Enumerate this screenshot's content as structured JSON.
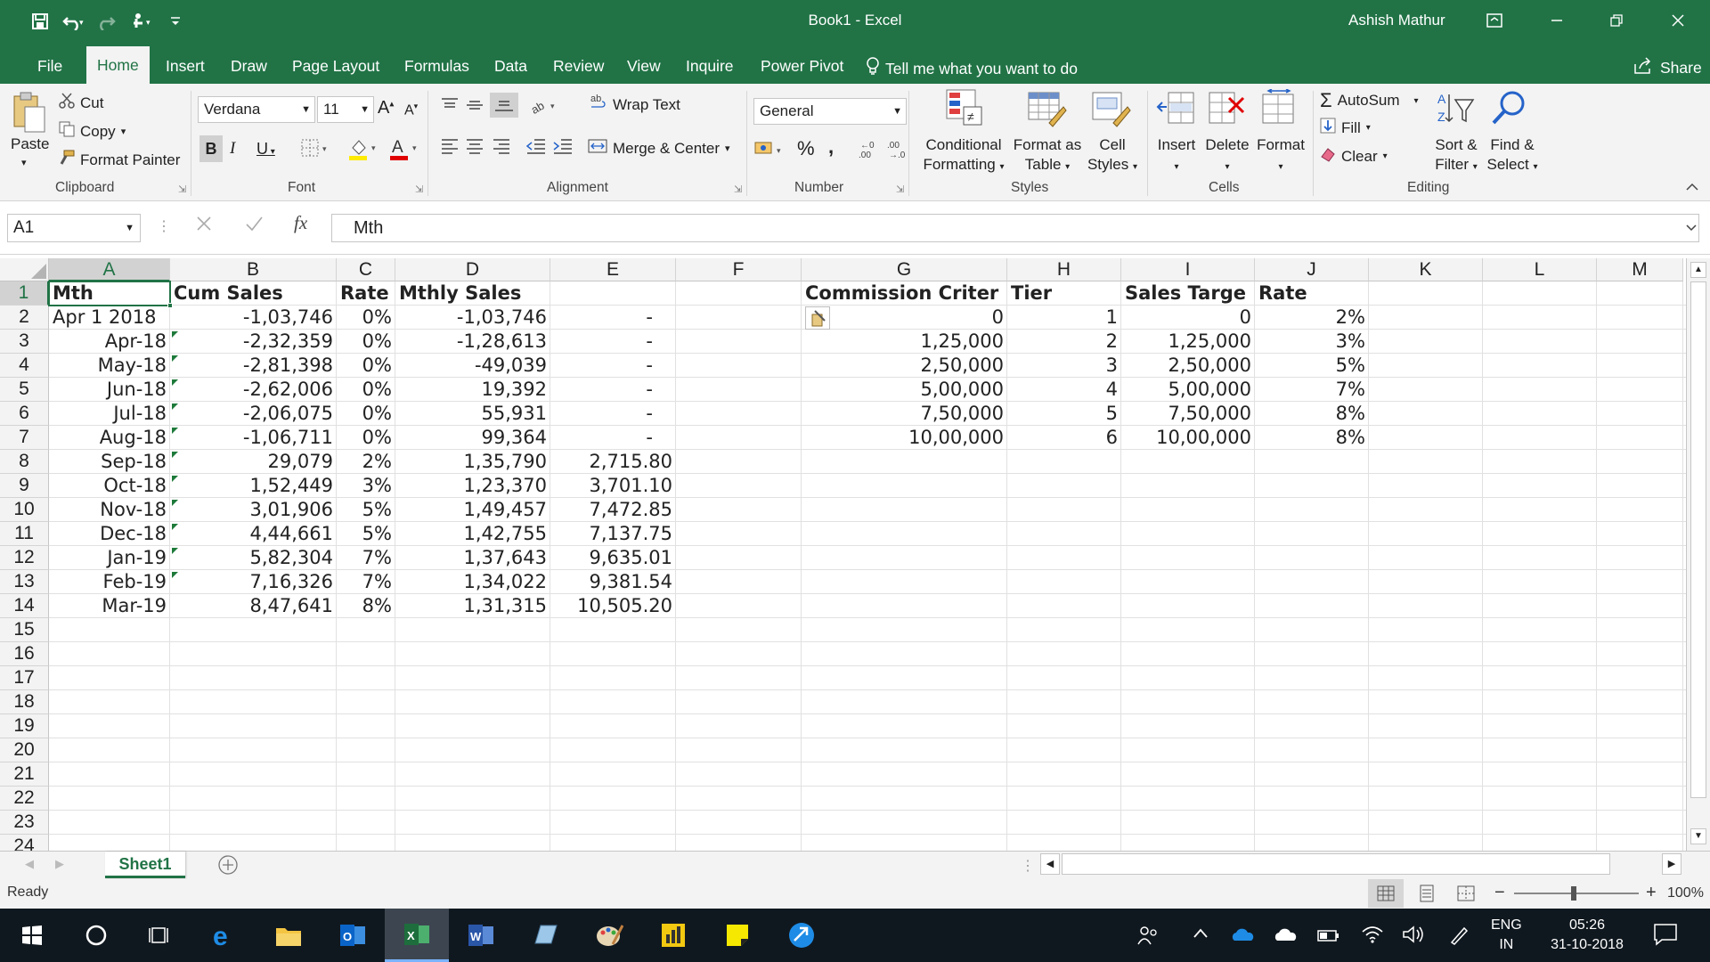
{
  "window": {
    "title": "Book1  -  Excel",
    "user": "Ashish Mathur",
    "accent": "#217346"
  },
  "tabs": [
    "File",
    "Home",
    "Insert",
    "Draw",
    "Page Layout",
    "Formulas",
    "Data",
    "Review",
    "View",
    "Inquire",
    "Power Pivot"
  ],
  "active_tab": "Home",
  "tell_me": "Tell me what you want to do",
  "share": "Share",
  "ribbon": {
    "clipboard": {
      "paste": "Paste",
      "cut": "Cut",
      "copy": "Copy",
      "format_painter": "Format Painter",
      "label": "Clipboard"
    },
    "font": {
      "name": "Verdana",
      "size": "11",
      "label": "Font"
    },
    "alignment": {
      "wrap": "Wrap Text",
      "merge": "Merge & Center",
      "label": "Alignment"
    },
    "number": {
      "format": "General",
      "percent": "%",
      "comma": ",",
      "label": "Number"
    },
    "styles": {
      "conditional1": "Conditional",
      "conditional2": "Formatting",
      "format_as1": "Format as",
      "format_as2": "Table",
      "cell1": "Cell",
      "cell2": "Styles",
      "label": "Styles"
    },
    "cells": {
      "insert": "Insert",
      "delete": "Delete",
      "format": "Format",
      "label": "Cells"
    },
    "editing": {
      "autosum": "AutoSum",
      "fill": "Fill",
      "clear": "Clear",
      "sort1": "Sort &",
      "sort2": "Filter",
      "find1": "Find &",
      "find2": "Select",
      "label": "Editing"
    }
  },
  "formula_bar": {
    "name_box": "A1",
    "fx": "fx",
    "value": "Mth"
  },
  "columns": [
    "A",
    "B",
    "C",
    "D",
    "E",
    "F",
    "G",
    "H",
    "I",
    "J",
    "K",
    "L",
    "M"
  ],
  "rows": [
    "1",
    "2",
    "3",
    "4",
    "5",
    "6",
    "7",
    "8",
    "9",
    "10",
    "11",
    "12",
    "13",
    "14",
    "15",
    "16",
    "17",
    "18",
    "19",
    "20",
    "21",
    "22",
    "23",
    "24"
  ],
  "table1": {
    "headers": [
      "Mth",
      "Cum Sales",
      "Rate",
      "Mthly Sales"
    ],
    "rows": [
      [
        "Apr 1 2018",
        "-1,03,746",
        "0%",
        "-1,03,746",
        "-"
      ],
      [
        "Apr-18",
        "-2,32,359",
        "0%",
        "-1,28,613",
        "-"
      ],
      [
        "May-18",
        "-2,81,398",
        "0%",
        "-49,039",
        "-"
      ],
      [
        "Jun-18",
        "-2,62,006",
        "0%",
        "19,392",
        "-"
      ],
      [
        "Jul-18",
        "-2,06,075",
        "0%",
        "55,931",
        "-"
      ],
      [
        "Aug-18",
        "-1,06,711",
        "0%",
        "99,364",
        "-"
      ],
      [
        "Sep-18",
        "29,079",
        "2%",
        "1,35,790",
        "2,715.80"
      ],
      [
        "Oct-18",
        "1,52,449",
        "3%",
        "1,23,370",
        "3,701.10"
      ],
      [
        "Nov-18",
        "3,01,906",
        "5%",
        "1,49,457",
        "7,472.85"
      ],
      [
        "Dec-18",
        "4,44,661",
        "5%",
        "1,42,755",
        "7,137.75"
      ],
      [
        "Jan-19",
        "5,82,304",
        "7%",
        "1,37,643",
        "9,635.01"
      ],
      [
        "Feb-19",
        "7,16,326",
        "7%",
        "1,34,022",
        "9,381.54"
      ],
      [
        "Mar-19",
        "8,47,641",
        "8%",
        "1,31,315",
        "10,505.20"
      ]
    ]
  },
  "table2": {
    "headers": [
      "Commission Criter",
      "Tier",
      "Sales Targe",
      "Rate"
    ],
    "rows": [
      [
        "0",
        "1",
        "0",
        "2%"
      ],
      [
        "1,25,000",
        "2",
        "1,25,000",
        "3%"
      ],
      [
        "2,50,000",
        "3",
        "2,50,000",
        "5%"
      ],
      [
        "5,00,000",
        "4",
        "5,00,000",
        "7%"
      ],
      [
        "7,50,000",
        "5",
        "7,50,000",
        "8%"
      ],
      [
        "10,00,000",
        "6",
        "10,00,000",
        "8%"
      ]
    ]
  },
  "sheet_tab": "Sheet1",
  "status": {
    "ready": "Ready",
    "zoom": "100%"
  },
  "taskbar": {
    "lang1": "ENG",
    "lang2": "IN",
    "time": "05:26",
    "date": "31-10-2018"
  }
}
